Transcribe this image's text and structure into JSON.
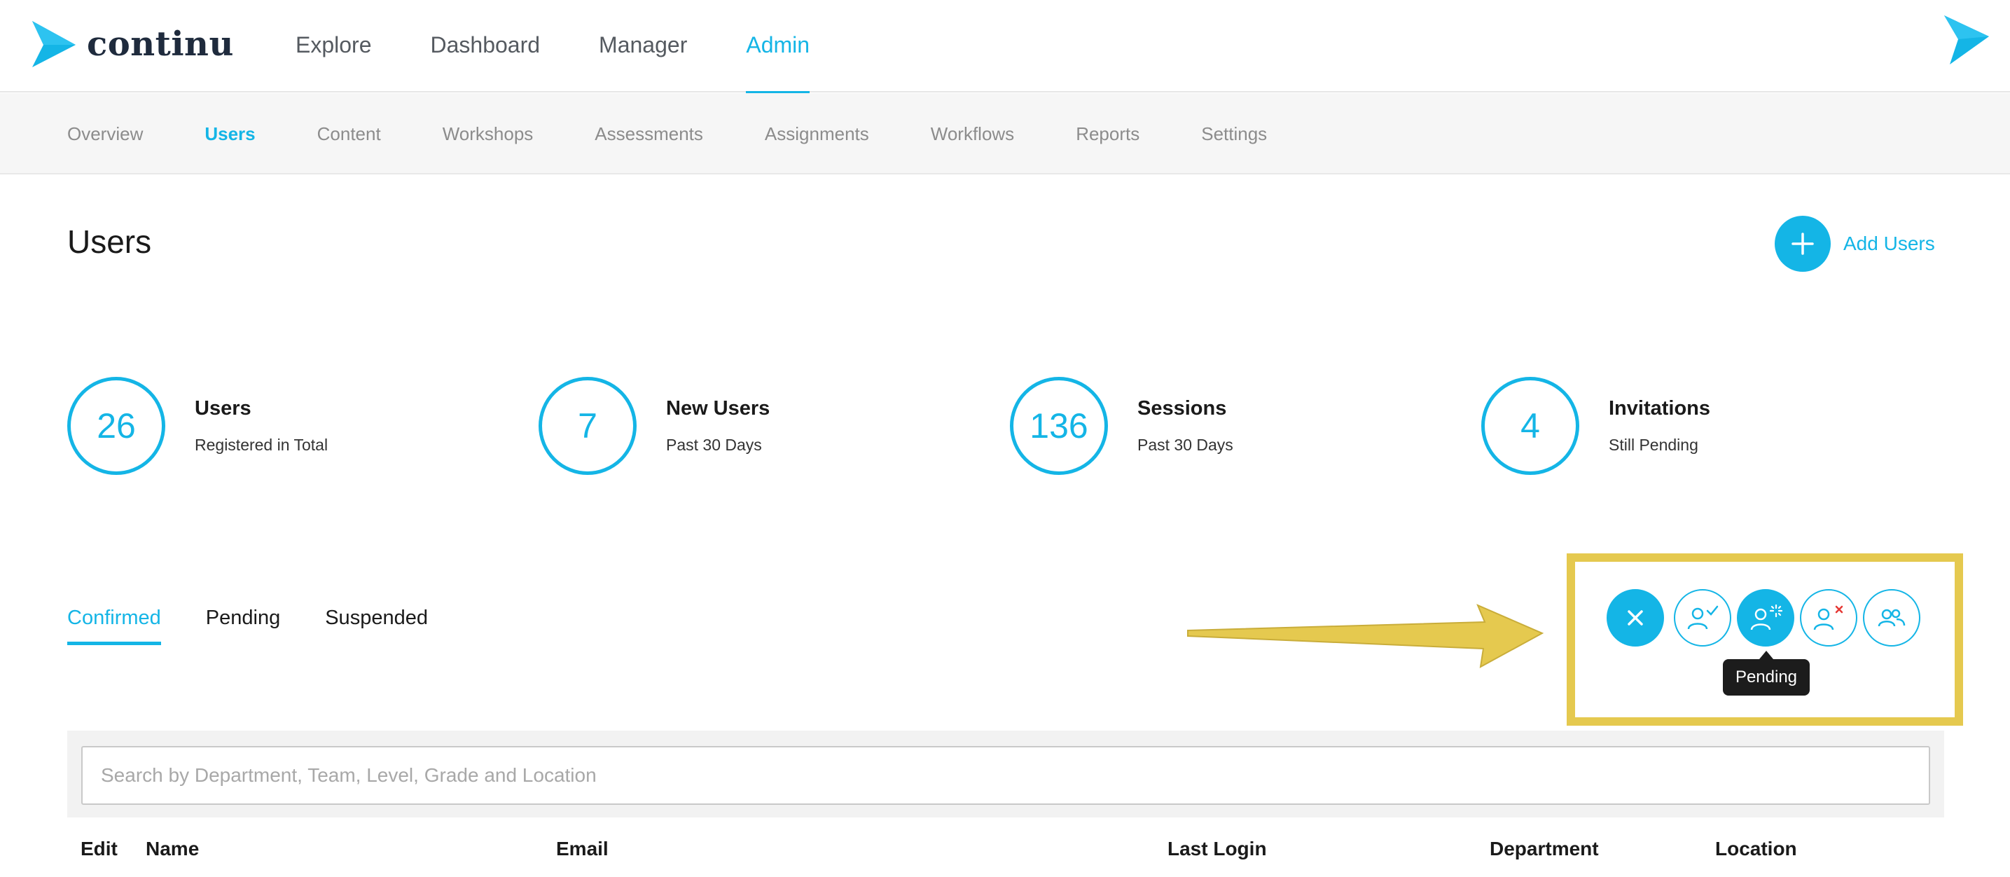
{
  "brand": {
    "name": "continu",
    "accent": "#14b5e6"
  },
  "main_nav": [
    {
      "label": "Explore",
      "active": false
    },
    {
      "label": "Dashboard",
      "active": false
    },
    {
      "label": "Manager",
      "active": false
    },
    {
      "label": "Admin",
      "active": true
    }
  ],
  "sub_nav": [
    {
      "label": "Overview",
      "active": false
    },
    {
      "label": "Users",
      "active": true
    },
    {
      "label": "Content",
      "active": false
    },
    {
      "label": "Workshops",
      "active": false
    },
    {
      "label": "Assessments",
      "active": false
    },
    {
      "label": "Assignments",
      "active": false
    },
    {
      "label": "Workflows",
      "active": false
    },
    {
      "label": "Reports",
      "active": false
    },
    {
      "label": "Settings",
      "active": false
    }
  ],
  "page": {
    "title": "Users",
    "add_button_label": "Add Users"
  },
  "stats": [
    {
      "value": "26",
      "title": "Users",
      "subtitle": "Registered in Total"
    },
    {
      "value": "7",
      "title": "New Users",
      "subtitle": "Past 30 Days"
    },
    {
      "value": "136",
      "title": "Sessions",
      "subtitle": "Past 30 Days"
    },
    {
      "value": "4",
      "title": "Invitations",
      "subtitle": "Still Pending"
    }
  ],
  "tabs": [
    {
      "label": "Confirmed",
      "active": true
    },
    {
      "label": "Pending",
      "active": false
    },
    {
      "label": "Suspended",
      "active": false
    }
  ],
  "filters": [
    {
      "icon": "close-icon",
      "selected": true
    },
    {
      "icon": "user-check-icon",
      "selected": false
    },
    {
      "icon": "user-pending-icon",
      "selected": true
    },
    {
      "icon": "user-x-icon",
      "selected": false
    },
    {
      "icon": "users-group-icon",
      "selected": false
    }
  ],
  "tooltip": {
    "text": "Pending"
  },
  "annotation": {
    "highlight_color": "#e5c94f"
  },
  "search": {
    "placeholder": "Search by Department, Team, Level, Grade and Location",
    "value": ""
  },
  "table": {
    "columns": [
      "Edit",
      "Name",
      "Email",
      "Last Login",
      "Department",
      "Location"
    ]
  }
}
